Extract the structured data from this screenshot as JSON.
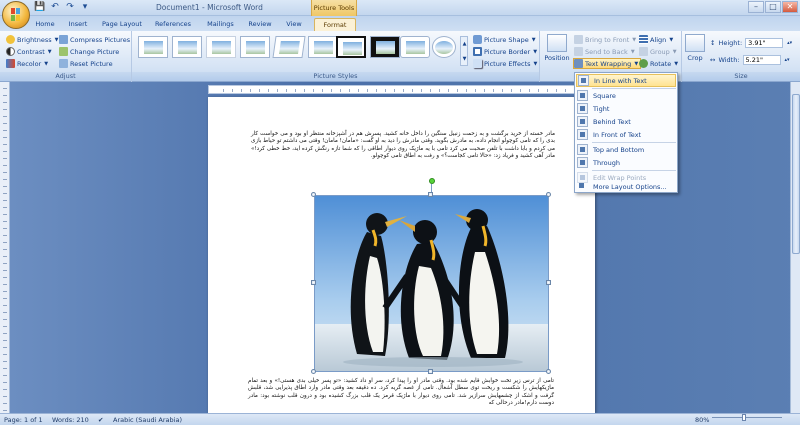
{
  "window": {
    "doc_title": "Document1 - Microsoft Word",
    "context_title": "Picture Tools"
  },
  "tabs": [
    "Home",
    "Insert",
    "Page Layout",
    "References",
    "Mailings",
    "Review",
    "View",
    "Format"
  ],
  "active_tab": "Format",
  "ribbon": {
    "adjust": {
      "label": "Adjust",
      "brightness": "Brightness",
      "contrast": "Contrast",
      "recolor": "Recolor",
      "compress": "Compress Pictures",
      "change": "Change Picture",
      "reset": "Reset Picture"
    },
    "styles": {
      "label": "Picture Styles",
      "shape": "Picture Shape",
      "border": "Picture Border",
      "effects": "Picture Effects"
    },
    "arrange": {
      "position": "Position",
      "bring_front": "Bring to Front",
      "send_back": "Send to Back",
      "text_wrapping": "Text Wrapping",
      "align": "Align",
      "group": "Group",
      "rotate": "Rotate"
    },
    "size": {
      "label": "Size",
      "crop": "Crop",
      "height_label": "Height:",
      "height_value": "3.91\"",
      "width_label": "Width:",
      "width_value": "5.21\""
    }
  },
  "wrap_menu": {
    "items": [
      {
        "label": "In Line with Text",
        "highlighted": true,
        "disabled": false
      },
      {
        "label": "Square",
        "highlighted": false,
        "disabled": false
      },
      {
        "label": "Tight",
        "highlighted": false,
        "disabled": false
      },
      {
        "label": "Behind Text",
        "highlighted": false,
        "disabled": false
      },
      {
        "label": "In Front of Text",
        "highlighted": false,
        "disabled": false
      },
      {
        "label": "Top and Bottom",
        "highlighted": false,
        "disabled": false
      },
      {
        "label": "Through",
        "highlighted": false,
        "disabled": false
      },
      {
        "label": "Edit Wrap Points",
        "highlighted": false,
        "disabled": true
      },
      {
        "label": "More Layout Options...",
        "highlighted": false,
        "disabled": false
      }
    ]
  },
  "document": {
    "para1": "مادر خسته از خرید برگشت و به زحمت زنبیل سنگین را داخل خانه کشید. پسرش هم در آشپزخانه منتظر او بود و می خواست کار بدی را که تامی کوچولو انجام داده، به مادرش بگوید. وقتی مادرش را دید به او گفت: «مامان! مامان! وقتی می داشتم تو حیاط بازی می کردم و بابا داشت با تلفن صحبت می کرد تامی با یه ماژیک روی دیوار اطاقی را که شما تازه رنگش کرده اید، خط خطی کرد!» مادر آهی کشید و فریاد زد: «حالا تامی کجاست؟» و رفت به اطاق تامی کوچولو.",
    "para2": "تامی از ترس زیر تخت خوابش قایم شده بود. وقتی مادر او را پیدا کرد، سر او داد کشید: «تو پسر خیلی بدی هستی!» و بعد تمام ماژیکهایش را شکست و ریخت توی سطل آشغال. تامی از غصه گریه کرد. ده دقیقه بعد وقتی مادر وارد اطاق پذیرایی شد، قلبش گرفت و اشک از چشمهایش سرازیر شد. تامی روی دیوار با ماژیک قرمز یک قلب بزرگ کشیده بود و درون قلب نوشته بود: مادر دوست دارم!مادر درحالی که"
  },
  "status": {
    "page": "Page: 1 of 1",
    "words": "Words: 210",
    "language": "Arabic (Saudi Arabia)",
    "zoom": "80%"
  },
  "colors": {
    "accent": "#15428b",
    "context_tab": "#efc766",
    "menu_highlight": "#ffe391"
  }
}
